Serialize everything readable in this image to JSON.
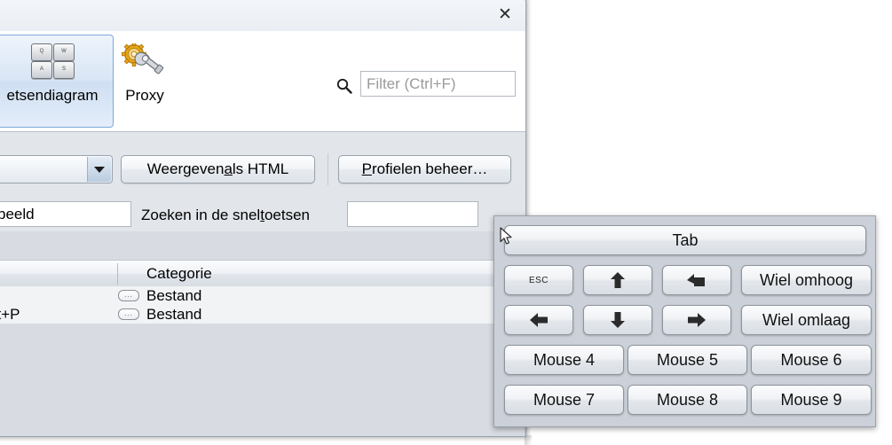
{
  "window": {
    "close_label": "✕"
  },
  "ribbon": {
    "keyboard_button": {
      "label": "etsendiagram",
      "icon": "keyboard-diagram-icon",
      "keys": [
        "Q",
        "W",
        "A",
        "S"
      ]
    },
    "proxy_button": {
      "label": "Proxy",
      "icon": "gear-wrench-icon"
    },
    "search_icon": "search-icon",
    "filter": {
      "value": "",
      "placeholder": "Filter (Ctrl+F)"
    }
  },
  "toolbar": {
    "profile_combo": {
      "value": "",
      "caret_icon": "chevron-down-icon"
    },
    "view_html_pre": "Weergeven ",
    "view_html_accel": "a",
    "view_html_post": "ls HTML",
    "manage_profiles_accel": "P",
    "manage_profiles_post": "rofielen beheer…"
  },
  "search_row": {
    "left_input_value": "beeld",
    "label_pre": "Zoeken in de snel",
    "label_accel": "t",
    "label_post": "oetsen",
    "right_input_value": ""
  },
  "table": {
    "headers": [
      {
        "label": ""
      },
      {
        "label": "Categorie"
      }
    ],
    "rows": [
      {
        "shortcut": "",
        "icon": "ellipsis-button-icon",
        "icon_glyph": "...",
        "category": "Bestand"
      },
      {
        "shortcut": "ift+P",
        "icon": "ellipsis-button-icon",
        "icon_glyph": "...",
        "category": "Bestand"
      }
    ]
  },
  "key_popup": {
    "tab_key": {
      "label": "Tab"
    },
    "row1": [
      {
        "label": "ESC",
        "style": "small",
        "icon": null
      },
      {
        "label": "",
        "icon": "arrow-up-icon"
      },
      {
        "label": "",
        "icon": "backspace-arrow-icon"
      },
      {
        "label": "Wiel omhoog",
        "icon": null
      }
    ],
    "row2": [
      {
        "label": "",
        "icon": "arrow-left-icon"
      },
      {
        "label": "",
        "icon": "arrow-down-icon"
      },
      {
        "label": "",
        "icon": "arrow-right-icon"
      },
      {
        "label": "Wiel omlaag",
        "icon": null
      }
    ],
    "row3": [
      {
        "label": "Mouse 4"
      },
      {
        "label": "Mouse 5"
      },
      {
        "label": "Mouse 6"
      }
    ],
    "row4": [
      {
        "label": "Mouse 7"
      },
      {
        "label": "Mouse 8"
      },
      {
        "label": "Mouse 9"
      }
    ]
  },
  "colors": {
    "window_bg": "#eef1f5",
    "ribbon_bg": "#ffffff",
    "toolbar_bg": "#e2e5ea",
    "popup_bg": "#ccd1d9",
    "selected_tab_border": "#7da7d9",
    "table_row_bg": "#f2f3f5"
  }
}
